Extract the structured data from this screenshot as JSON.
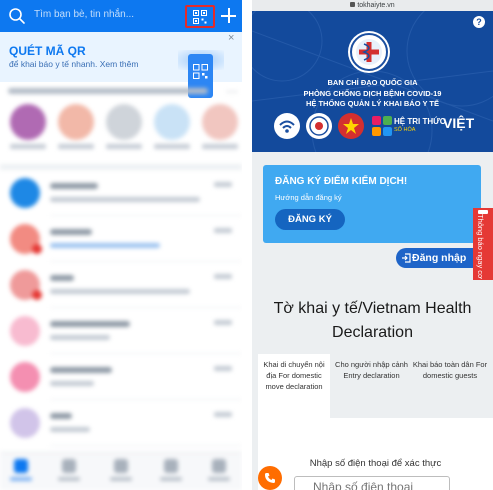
{
  "left_app": {
    "search_placeholder": "Tìm bạn bè, tin nhắn...",
    "qr_banner": {
      "title": "QUÉT MÃ QR",
      "description": "để khai báo y tế nhanh. Xem thêm",
      "close_glyph": "×"
    },
    "icons": [
      "search-icon",
      "qr-scan-icon",
      "plus-icon",
      "close-icon"
    ],
    "colors": {
      "header": "#0d78f0",
      "highlight_border": "#e32b2b",
      "banner_bg": "#e9f4ff"
    }
  },
  "right_site": {
    "url": "tokhaiyte.vn",
    "help_glyph": "?",
    "hero": {
      "line1": "BAN CHỈ ĐẠO QUỐC GIA",
      "line2": "PHÒNG CHỐNG DỊCH BỆNH COVID-19",
      "line3": "HỆ THỐNG QUẢN LÝ KHAI BÁO Y TẾ",
      "logo_text": "HỆ TRI THỨC",
      "logo_text_2": "VIỆT",
      "logo_text_3": "SỐ HÓA"
    },
    "registration": {
      "title": "ĐĂNG KÝ ĐIỂM KIỂM DỊCH!",
      "guide_link": "Hướng dẫn đăng ký",
      "button": "ĐĂNG KÝ"
    },
    "login_button": "Đăng nhập",
    "feedback_tab": "Thông báo ngay cơ",
    "main_title": "Tờ khai y tế/Vietnam Health Declaration",
    "tabs": [
      {
        "label": "Khai di chuyển nội địa For domestic move declaration"
      },
      {
        "label": "Cho người nhập cảnh Entry declaration"
      },
      {
        "label": "Khai báo toàn dân For domestic guests"
      }
    ],
    "phone_form": {
      "label": "Nhập số điện thoại để xác thực",
      "placeholder": "Nhập số điện thoại"
    },
    "colors": {
      "hero_bg": "#134a9c",
      "card_bg": "#40a9f1",
      "primary_button": "#1565c0",
      "feedback": "#e53935",
      "fab": "#ff6d00"
    }
  }
}
